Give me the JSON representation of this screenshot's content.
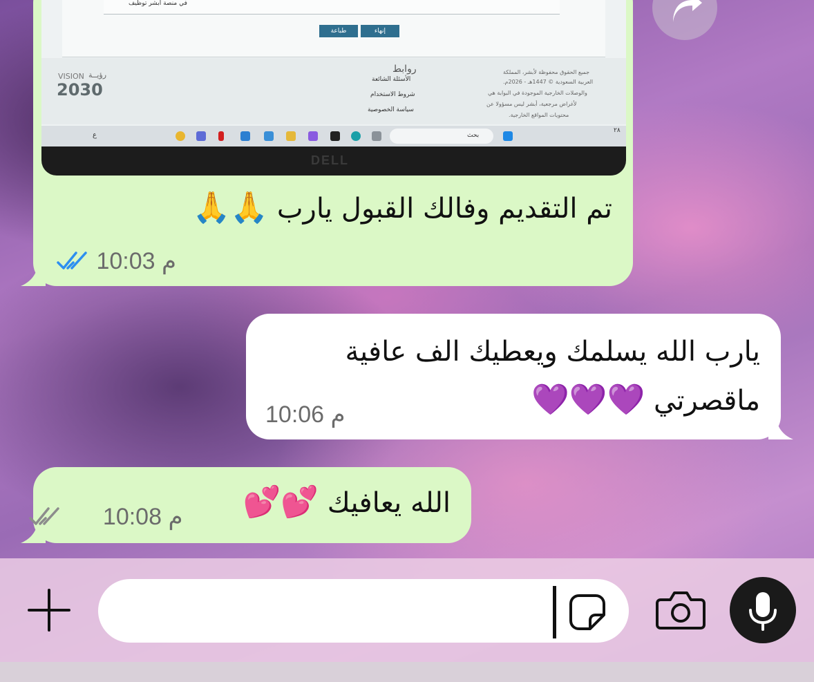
{
  "messages": [
    {
      "direction": "outgoing",
      "type": "image+text",
      "image": {
        "ui_snippets": {
          "field_note": "في منصة أبشر توظيف",
          "btn_finish": "إنهاء",
          "btn_print": "طباعة",
          "links_title": "روابط",
          "link_faq": "الأسئلة الشائعة",
          "link_terms": "شروط الاستخدام",
          "link_privacy": "سياسة الخصوصية",
          "vision_small": "رؤيــة",
          "vision_label": "VISION",
          "vision_year": "2030",
          "copyright_1": "جميع الحقوق محفوظة لأبشر، المملكة",
          "copyright_2": "العربية السعودية © 1447هـ - 2026م.",
          "copyright_3": "والوصلات الخارجية الموجودة في البوابة هي",
          "copyright_4": "لأغراض مرجعية، أبشر ليس مسؤولا عن",
          "copyright_5": "محتويات المواقع الخارجية.",
          "taskbar_search": "بحث",
          "taskbar_lang": "ع",
          "taskbar_number": "٢٨",
          "brand": "DELL"
        }
      },
      "text": "تم التقديم وفالك القبول يارب",
      "emoji": "🙏🙏",
      "time": "10:03",
      "ampm": "م",
      "status": "read",
      "status_color": "#2d8ff0"
    },
    {
      "direction": "incoming",
      "type": "text",
      "line1": "يارب الله يسلمك ويعطيك الف عافية",
      "line2": "ماقصرتي",
      "emoji": "💜💜💜",
      "time": "10:06",
      "ampm": "م"
    },
    {
      "direction": "outgoing",
      "type": "text",
      "text": "الله يعافيك",
      "emoji": "💕💕",
      "time": "10:08",
      "ampm": "م",
      "status": "delivered",
      "status_color": "#8c8c8c"
    }
  ],
  "composer": {
    "input_value": "",
    "icons": {
      "attach": "plus-icon",
      "sticker": "sticker-icon",
      "camera": "camera-icon",
      "mic": "microphone-icon",
      "forward": "forward-icon"
    }
  },
  "colors": {
    "outgoing_bubble": "#dbf8c6",
    "incoming_bubble": "#ffffff"
  }
}
